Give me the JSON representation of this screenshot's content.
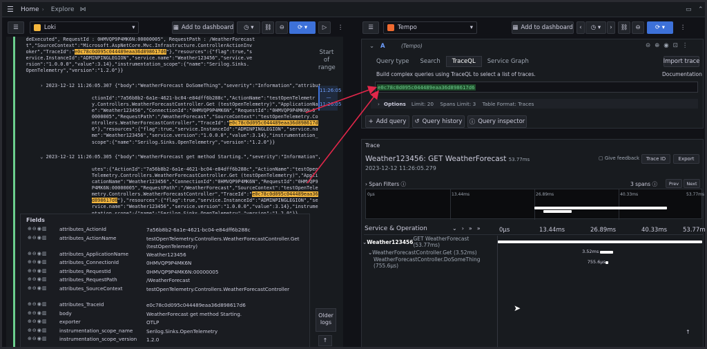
{
  "topbar": {
    "home": "Home",
    "explore": "Explore"
  },
  "left": {
    "datasource": "Loki",
    "add_dashboard": "Add to dashboard",
    "log_lines": [
      "   deExecuted\", RequestId : 0HMVQP9P4MK6N:00000005\", RequestPath : /WeatherForecast",
      "   t\",\"SourceContext\":\"Microsoft.AspNetCore.Mvc.Infrastructure.ControllerActionInv",
      "   oker\",\"TraceId\":\"e0c78c0d095c044489eaa36d898617d6\"},\"resources\":{\"flag\":true,\"s",
      "   ervice.InstanceId\":\"ADMINPINGLEGION\",\"service.name\":\"Weather123456\",\"service.ve",
      "   rsion\":\"1.0.0.0\",\"value\":3.14},\"instrumentation_scope\":{\"name\":\"Serilog.Sinks.",
      "   OpenTelemetry\",\"version\":\"1.2.0\"}}"
    ],
    "entry1_ts": "2023-12-12 11:26:05.307",
    "entry1_lines": [
      "{\"body\":\"WeatherForecast DoSomeThing\",\"severity\":\"Information\",\"attributes\":{\"A",
      "ctionId\":\"7a56b8b2-6a1e-4621-bc04-e84dff6b288c\",\"ActionName\":\"testOpenTelemetr",
      "y.Controllers.WeatherForecastController.Get (testOpenTelemetry)\",\"ApplicationNam",
      "e\":\"Weather123456\",\"ConnectionId\":\"0HMVQP9P4MK6N\",\"RequestId\":\"0HMVQP9P4MK6N:0",
      "0000005\",\"RequestPath\":\"/WeatherForecast\",\"SourceContext\":\"testOpenTelemetry.Co",
      "ntrollers.WeatherForecastController\",\"TraceId\":\"e0c78c0d095c044489eaa36d898617d",
      "6\"},\"resources\":{\"flag\":true,\"service.InstanceId\":\"ADMINPINGLEGION\",\"service.na",
      "me\":\"Weather123456\",\"service.version\":\"1.0.0.0\",\"value\":3.14},\"instrumentation_",
      "scope\":{\"name\":\"Serilog.Sinks.OpenTelemetry\",\"version\":\"1.2.0\"}}"
    ],
    "entry2_ts": "2023-12-12 11:26:05.305",
    "entry2_lines": [
      "{\"body\":\"WeatherForecast get method Starting.\",\"severity\":\"Information\",\"attrib",
      "utes\":{\"ActionId\":\"7a56b8b2-6a1e-4621-bc04-e84dff6b288c\",\"ActionName\":\"testOpen",
      "Telemetry.Controllers.WeatherForecastController.Get (testOpenTelemetry)\",\"Appli",
      "cationName\":\"Weather123456\",\"ConnectionId\":\"0HMVQP9P4MK6N\",\"RequestId\":\"0HMVQP9",
      "P4MK6N:00000005\",\"RequestPath\":\"/WeatherForecast\",\"SourceContext\":\"testOpenTele",
      "metry.Controllers.WeatherForecastController\",\"TraceId\":\"e0c78c0d095c044489eaa36",
      "d898617d6\"},\"resources\":{\"flag\":true,\"service.InstanceId\":\"ADMINPINGLEGION\",\"se",
      "rvice.name\":\"Weather123456\",\"service.version\":\"1.0.0.0\",\"value\":3.14},\"instrume",
      "ntation_scope\":{\"name\":\"Serilog.Sinks.OpenTelemetry\",\"version\":\"1.2.0\"}}"
    ],
    "range_start": "Start of range",
    "range_sel": "11:26:05 — 11:26:05",
    "older_logs": "Older logs",
    "fields_title": "Fields",
    "fields": [
      {
        "name": "attributes_ActionId",
        "value": "7a56b8b2-6a1e-4621-bc04-e84dff6b288c"
      },
      {
        "name": "attributes_ActionName",
        "value": "testOpenTelemetry.Controllers.WeatherForecastController.Get (testOpenTelemetry)"
      },
      {
        "name": "attributes_ApplicationName",
        "value": "Weather123456"
      },
      {
        "name": "attributes_ConnectionId",
        "value": "0HMVQP9P4MK6N"
      },
      {
        "name": "attributes_RequestId",
        "value": "0HMVQP9P4MK6N:00000005"
      },
      {
        "name": "attributes_RequestPath",
        "value": "/WeatherForecast"
      },
      {
        "name": "attributes_SourceContext",
        "value": "testOpenTelemetry.Controllers.WeatherForecastController"
      },
      {
        "name": "attributes_TraceId",
        "value": "e0c78c0d095c044489eaa36d898617d6"
      },
      {
        "name": "body",
        "value": "WeatherForecast get method Starting."
      },
      {
        "name": "exporter",
        "value": "OTLP"
      },
      {
        "name": "instrumentation_scope_name",
        "value": "Serilog.Sinks.OpenTelemetry"
      },
      {
        "name": "instrumentation_scope_version",
        "value": "1.2.0"
      }
    ]
  },
  "right": {
    "datasource": "Tempo",
    "add_dashboard": "Add to dashboard",
    "query_letter": "A",
    "query_ds": "(Tempo)",
    "query_type_label": "Query type",
    "tabs": [
      "Search",
      "TraceQL",
      "Service Graph"
    ],
    "import_trace": "Import trace",
    "help": "Build complex queries using TraceQL to select a list of traces.",
    "documentation": "Documentation",
    "query_value": "e0c78c0d095c044489eaa36d898617d6",
    "options_label": "Options",
    "options": "Limit: 20    Spans Limit: 3    Table Format: Traces",
    "add_query": "Add query",
    "query_history": "Query history",
    "query_inspector": "Query inspector",
    "trace_label": "Trace",
    "trace_title": "Weather123456: GET WeatherForecast",
    "trace_duration": "53.77ms",
    "trace_date": "2023-12-12 11:26:05.279",
    "give_feedback": "Give feedback",
    "trace_id_btn": "Trace ID",
    "export_btn": "Export",
    "span_filters": "Span Filters",
    "spans_count": "3 spans",
    "prev": "Prev",
    "next": "Next",
    "minimap_ticks": [
      "0μs",
      "13.44ms",
      "26.89ms",
      "40.33ms",
      "53.77ms"
    ],
    "svc_header": "Service & Operation",
    "timeline_ticks": [
      "0μs",
      "13.44ms",
      "26.89ms",
      "40.33ms",
      "53.77ms"
    ],
    "spans": [
      {
        "service": "Weather123456",
        "op": "GET WeatherForecast (53.77ms)",
        "label": "",
        "start": 0,
        "dur": 53.77
      },
      {
        "service": "",
        "op": "WeatherForecastController.Get (3.52ms)",
        "label": "3.52ms",
        "start": 26.9,
        "dur": 3.52
      },
      {
        "service": "",
        "op": "WeatherForecastController.DoSomeThing (755.6μs)",
        "label": "755.6μs",
        "start": 28.3,
        "dur": 0.756
      }
    ]
  }
}
